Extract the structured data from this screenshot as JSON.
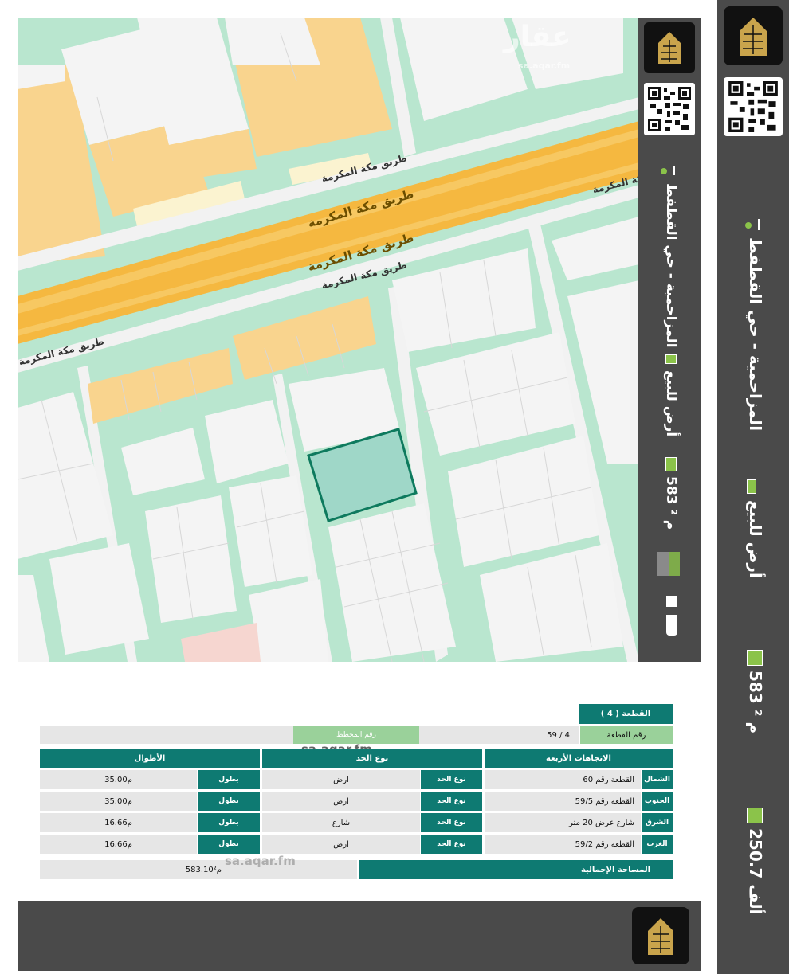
{
  "sidebar": {
    "location": "المزاحمية - حي القطفط",
    "listing_type": "أرض للبيع",
    "area": "583 م ²",
    "price": "250.7 ألف"
  },
  "map": {
    "road_main_1": "طريق مكة المكرمة",
    "road_main_2": "طريق مكة المكرمة",
    "road_service_top": "طريق مكة المكرمة",
    "road_service_bottom": "طريق مكة المكرمة",
    "road_service_left": "طريق مكة المكرمة",
    "road_service_right": "مكة المكرمة",
    "watermark": "عقار",
    "watermark_url": "sa.aqar.fm"
  },
  "map_panel": {
    "location": "المزاحمية - حي القطفط",
    "listing_type": "أرض للبيع",
    "area": "583 م ²"
  },
  "table": {
    "title": "القطعة ( 4 )",
    "plot_label": "رقم القطعة",
    "plot_value": "59 / 4",
    "plan_label": "رقم المخطط",
    "headers": {
      "directions": "الاتجاهات الأربعة",
      "border_type": "نوع الحد",
      "lengths": "الأطوال"
    },
    "rows": [
      {
        "dir": "الشمال",
        "neighbor": "القطعة رقم 60",
        "type_label": "نوع الحد",
        "type_value": "ارض",
        "len_label": "بطول",
        "len_value": "35.00م"
      },
      {
        "dir": "الجنوب",
        "neighbor": "القطعة رقم 59/5",
        "type_label": "نوع الحد",
        "type_value": "ارض",
        "len_label": "بطول",
        "len_value": "35.00م"
      },
      {
        "dir": "الشرق",
        "neighbor": "شارع عرض 20 متر",
        "type_label": "نوع الحد",
        "type_value": "شارع",
        "len_label": "بطول",
        "len_value": "16.66م"
      },
      {
        "dir": "الغرب",
        "neighbor": "القطعة رقم 59/2",
        "type_label": "نوع الحد",
        "type_value": "ارض",
        "len_label": "بطول",
        "len_value": "16.66م"
      }
    ],
    "total_label": "المساحة الإجمالية",
    "total_value": "583.10م²",
    "watermark_1": "sa.aqar.fm",
    "watermark_2": "sa.aqar.fm"
  },
  "colors": {
    "sidebar_bg": "#4a4a4a",
    "accent_green": "#8bc34a",
    "teal": "#0e7a72",
    "map_bg": "#b9e6cf",
    "plot_outline": "#0e7a5e"
  }
}
